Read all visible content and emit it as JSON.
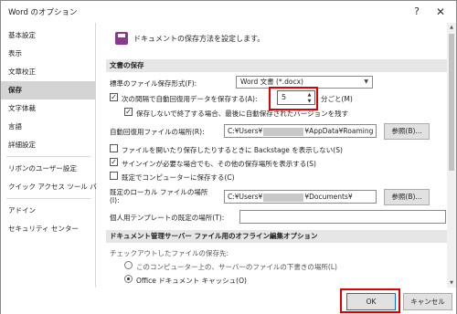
{
  "window": {
    "title": "Word のオプション",
    "help": "?",
    "close": "✕"
  },
  "sidebar": {
    "items": [
      {
        "label": "基本設定"
      },
      {
        "label": "表示"
      },
      {
        "label": "文章校正"
      },
      {
        "label": "保存",
        "active": true
      },
      {
        "label": "文字体裁"
      },
      {
        "label": "言語"
      },
      {
        "label": "詳細設定"
      },
      {
        "label": "リボンのユーザー設定"
      },
      {
        "label": "クイック アクセス ツール バー"
      },
      {
        "label": "アドイン"
      },
      {
        "label": "セキュリティ センター"
      }
    ]
  },
  "content": {
    "header_icon": "save-document-icon",
    "header": "ドキュメントの保存方法を設定します。",
    "sections": {
      "save": "文書の保存",
      "server": "ドキュメント管理サーバー ファイル用のオフライン編集オプション"
    },
    "format": {
      "label": "標準のファイル保存形式(F):",
      "value": "Word 文書 (*.docx)"
    },
    "autorecover": {
      "label": "次の間隔で自動回復用データを保存する(A):",
      "value": "5",
      "unit": "分ごと(M)",
      "checked": true
    },
    "keep_last": {
      "label": "保存しないで終了する場合、最後に自動保存されたバージョンを残す",
      "checked": true
    },
    "recover_location": {
      "label": "自動回復用ファイルの場所(R):",
      "prefix": "C:¥Users¥",
      "suffix": "¥AppData¥Roaming",
      "browse": "参照(B)..."
    },
    "backstage": {
      "label": "ファイルを開いたり保存したりするときに Backstage を表示しない(S)",
      "checked": false
    },
    "signin": {
      "label": "サインインが必要な場合でも、その他の保存場所を表示する(S)",
      "checked": true
    },
    "default_local": {
      "label": "既定でコンピューターに保存する(C)",
      "checked": false
    },
    "local_location": {
      "label_line1": "既定のローカル ファイルの場所",
      "label_line2": "(I):",
      "prefix": "C:¥Users¥",
      "suffix": "¥Documents¥",
      "browse": "参照(B)..."
    },
    "template_location": {
      "label": "個人用テンプレートの既定の場所(T):",
      "value": ""
    },
    "checkout": {
      "label": "チェックアウトしたファイルの保存先:",
      "option1": "このコンピューター上の、サーバーのファイルの下書きの場所(L)",
      "option2": "Office ドキュメント キャッシュ(O)"
    }
  },
  "footer": {
    "ok": "OK",
    "cancel": "キャンセル"
  },
  "colors": {
    "highlight": "#e00000",
    "active_sidebar": "#d4d4d4",
    "section_bg": "#e6e6e6"
  }
}
